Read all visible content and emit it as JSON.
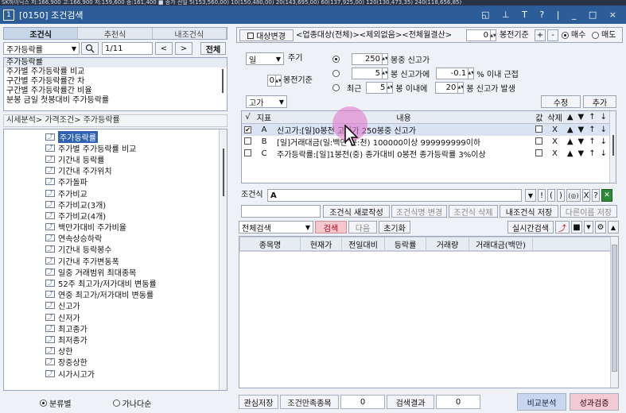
{
  "ticker": "SK하이닉스 저:166,900 고:166,900 저:159,600 종:161,400  ■ 종가 전일 5(153,560,00) 10(150,480,00) 20(143,695,00) 60(137,925,00) 120(130,473,35) 240(118,656,85)",
  "window": {
    "title": "[0150] 조건검색",
    "num": "1",
    "controls": "◱ ⊥ T ? | _ □ ×"
  },
  "left": {
    "tabs": [
      "조건식",
      "추천식",
      "내조건식"
    ],
    "search": {
      "value": "주가등락률",
      "page": "1/11",
      "prev": "<",
      "next": ">",
      "all": "전체"
    },
    "list_items": [
      "주가등락률",
      "주가별 주가등락률 비교",
      "구간별 주가등락률간 차",
      "구간별 주가등락률간 비율",
      "분봉 금일 첫봉대비 주가등락률"
    ],
    "breadcrumb": "시세분석> 가격조건> 주가등락률",
    "tree_items": [
      "주가등락률",
      "주가별 주가등락률 비교",
      "기간내 등락률",
      "기간내 주가위치",
      "주가돌파",
      "주가비교",
      "주가비교(3개)",
      "주가비교(4개)",
      "백만가대비 주가비율",
      "연속상승하락",
      "기간내 등락봉수",
      "기간내 주가변동폭",
      "일중 거래범위 최대종목",
      "52주 최고가/저가대비 변동률",
      "연중 최고가/저가대비 변동률",
      "신고가",
      "신저가",
      "최고종가",
      "최저종가",
      "상한",
      "장중상한",
      "시가시고가"
    ],
    "radio1": "분류별",
    "radio2": "가나다순"
  },
  "right": {
    "target_btn": "대상변경",
    "target_text": "<업종대상(전체)><제외없음><전체월결산>",
    "base_val": "0",
    "base_lbl": "봉전기준",
    "plus": "+",
    "minus": "-",
    "buy": "매수",
    "sell": "매도",
    "period": "일",
    "period_lbl": "주기",
    "base2_val": "0",
    "base2_lbl": "봉전기준",
    "opt1": {
      "num": "250",
      "text": "봉중 신고가"
    },
    "opt2": {
      "num": "5",
      "text": "봉 신고가에",
      "num2": "-0.1",
      "text2": "% 이내 근접"
    },
    "opt3": {
      "pre": "최근",
      "num": "5",
      "text": "봉 이내에",
      "num2": "20",
      "text2": "봉 신고가 발생"
    },
    "kind": "고가",
    "edit": "수정",
    "add": "추가",
    "table_headers": [
      "√",
      "지표",
      "내용",
      "값",
      "삭제",
      "▲",
      "▼",
      "↑",
      "↓"
    ],
    "rows": [
      {
        "checked": "✔",
        "id": "A",
        "content": "신고가:[일]0봉전 고가가 250봉중 신고가",
        "del": "X"
      },
      {
        "checked": "",
        "id": "B",
        "content": "[일]거래대금(일:백만 분:천) 100000이상 999999999이하",
        "del": "X"
      },
      {
        "checked": "",
        "id": "C",
        "content": "주가등락률:[일]1봉전(중) 종가대비 0봉전 종가등락률 3%이상",
        "del": "X"
      }
    ],
    "formula_lbl": "조건식",
    "formula_value": "A",
    "formula_tools": [
      "▼",
      "!",
      "(",
      ")",
      "(◎)",
      "X",
      "?"
    ],
    "formula_btns": [
      "조건식 새로작성",
      "조건식명 변경",
      "조건식 삭제",
      "내조건식 저장",
      "다른이름 저장"
    ],
    "scope": "전체검색",
    "search_btn": "검색",
    "next_btn": "다음",
    "reset_btn": "초기화",
    "realtime_btn": "실시간검색",
    "result_headers": [
      "종목명",
      "현재가",
      "전일대비",
      "등락률",
      "거래량",
      "거래대금(백만)"
    ],
    "bottom": {
      "save": "관심저장",
      "count_lbl": "조건만족종목",
      "count": "0",
      "result_lbl": "검색결과",
      "result": "0",
      "compare": "비교분석",
      "perf": "성과검증"
    }
  },
  "colors": {
    "title_bar": "#2c5d99",
    "selected": "#2f62b2",
    "search_btn": "#f4c7cc",
    "compare_btn": "#c8d6f0",
    "perf_btn": "#f3c9d6",
    "cursor_highlight": "#e070c8"
  }
}
